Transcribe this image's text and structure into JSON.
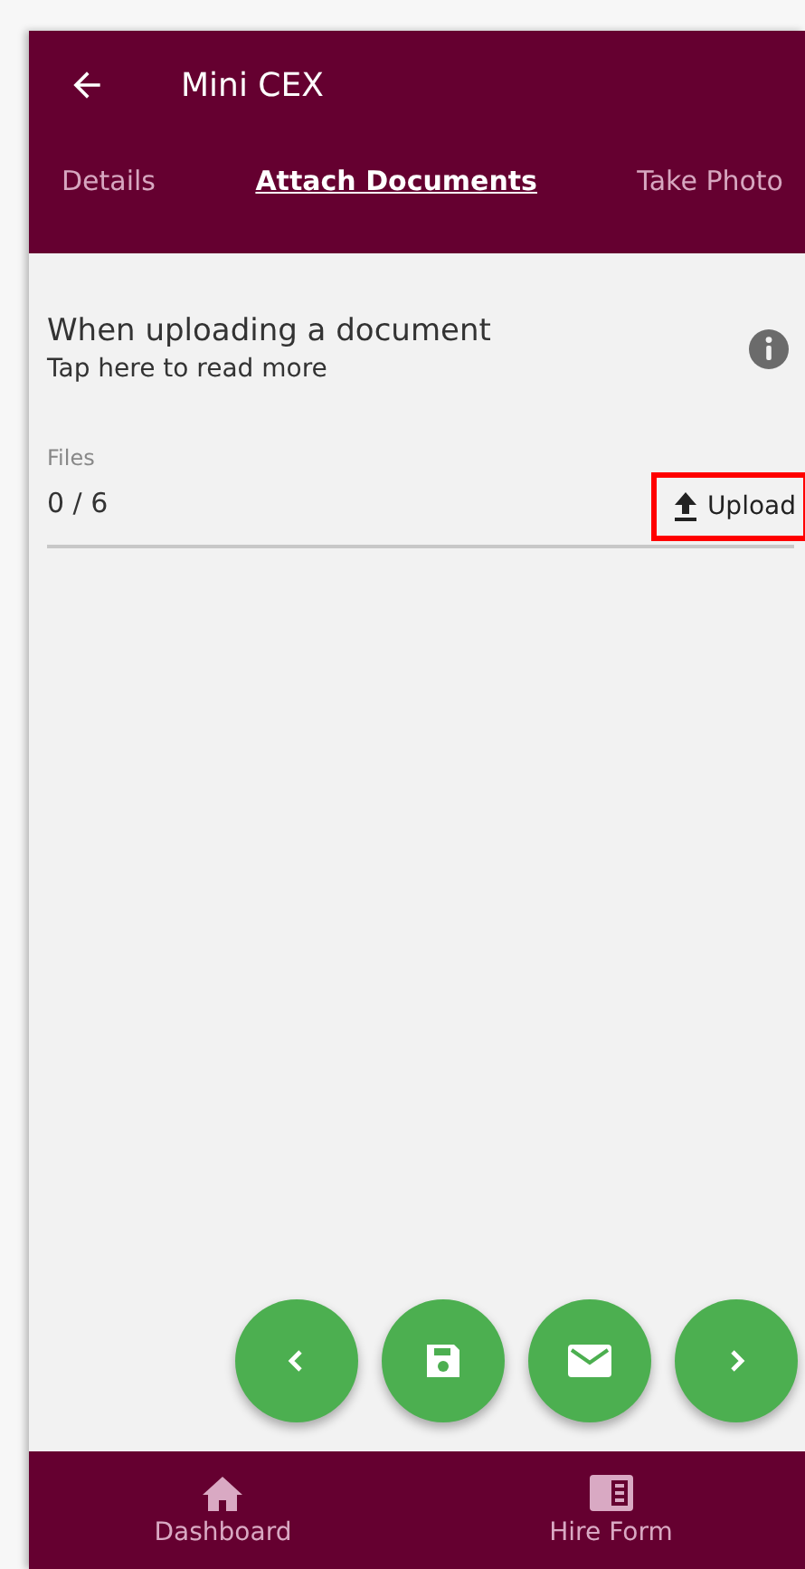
{
  "app_bar": {
    "title": "Mini CEX"
  },
  "tabs": [
    {
      "label": "Details",
      "selected": false
    },
    {
      "label": "Attach Documents",
      "selected": true
    },
    {
      "label": "Take Photo",
      "selected": false
    }
  ],
  "notice": {
    "title": "When uploading a document",
    "link": "Tap here to read more"
  },
  "files": {
    "label": "Files",
    "count": "0 / 6",
    "upload": "Upload",
    "highlighted": true
  },
  "fab_buttons": [
    {
      "kind": "previous"
    },
    {
      "kind": "save"
    },
    {
      "kind": "email"
    },
    {
      "kind": "next"
    }
  ],
  "bottom_nav": [
    {
      "kind": "home",
      "label": "Dashboard"
    },
    {
      "kind": "form",
      "label": "Hire Form"
    }
  ]
}
